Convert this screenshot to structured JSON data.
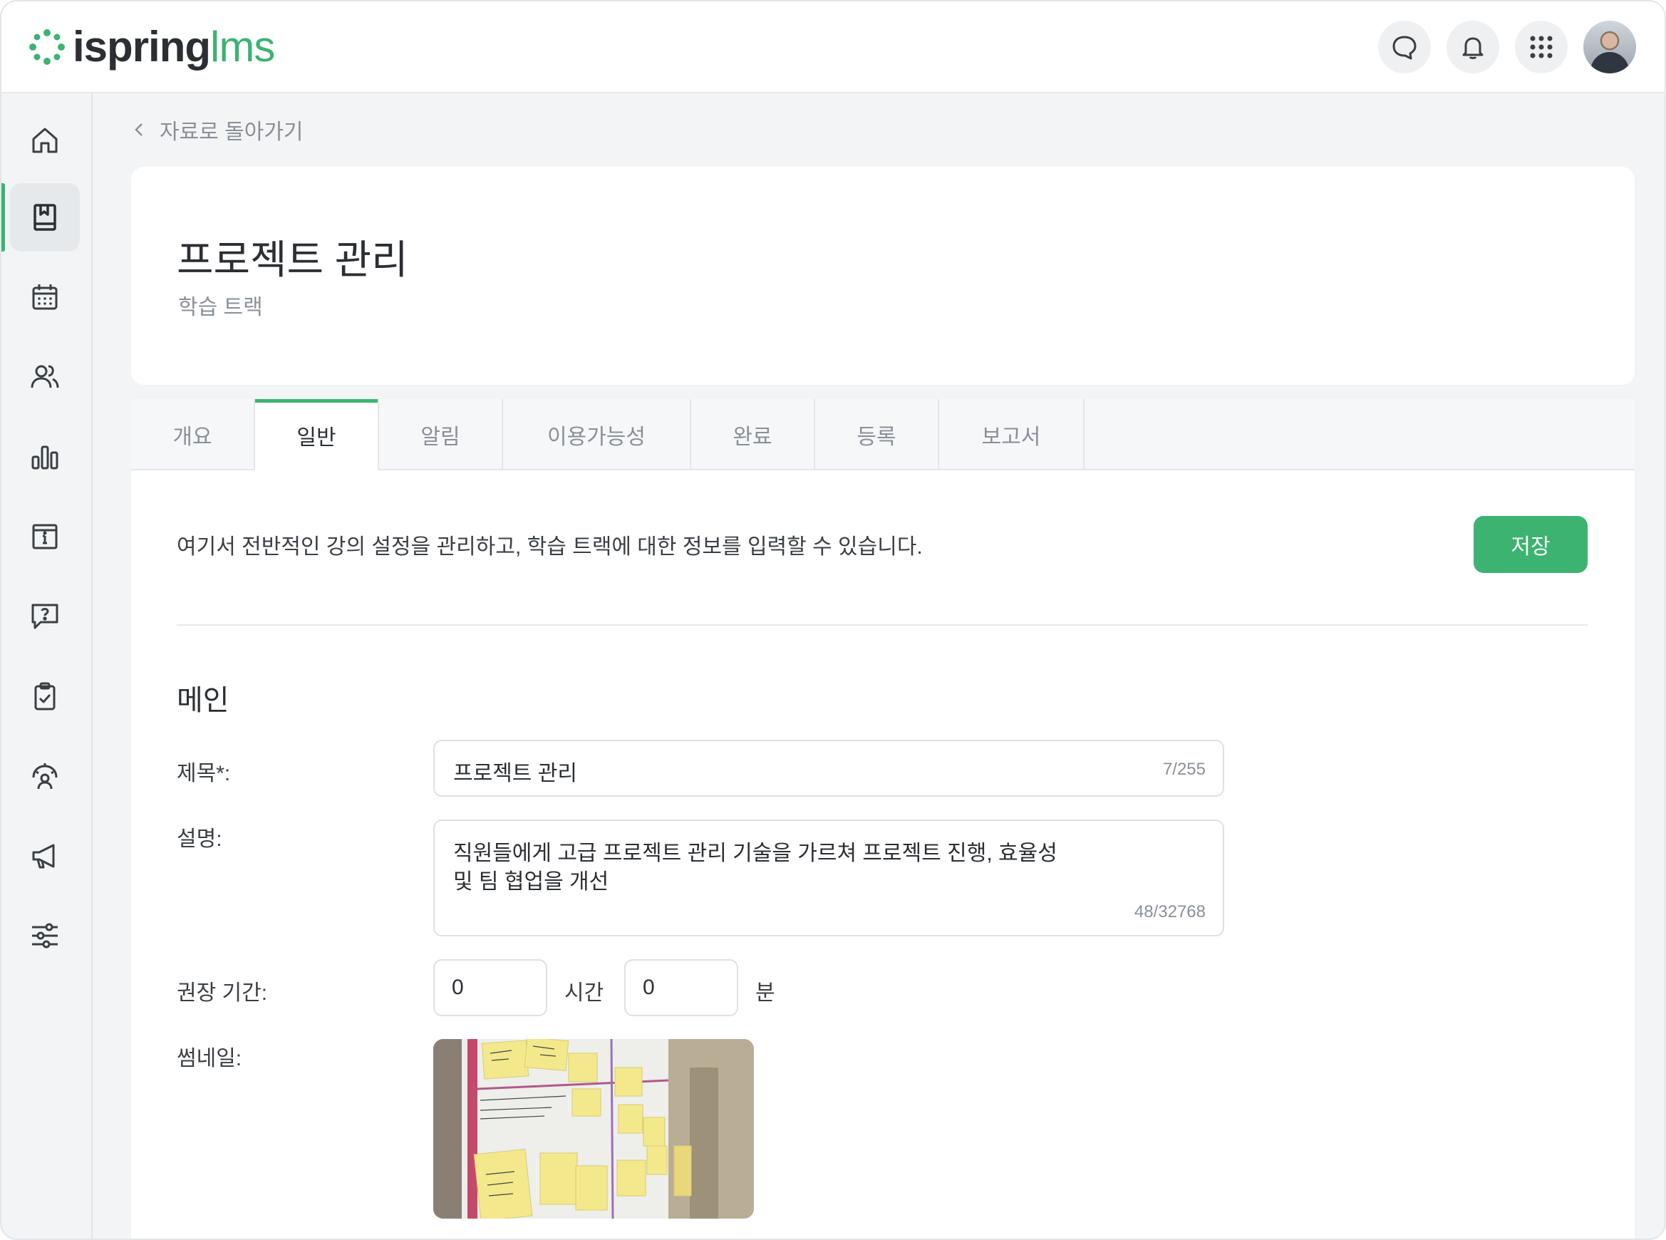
{
  "app": {
    "logo_primary": "ispring",
    "logo_secondary": "lms",
    "brand_color": "#3cb371"
  },
  "topbar": {
    "icons": [
      "chat-icon",
      "bell-icon",
      "apps-grid-icon"
    ],
    "avatar": "user-avatar"
  },
  "sidebar": {
    "items": [
      {
        "icon": "home-icon",
        "active": false
      },
      {
        "icon": "library-book-icon",
        "active": true
      },
      {
        "icon": "calendar-icon",
        "active": false
      },
      {
        "icon": "users-icon",
        "active": false
      },
      {
        "icon": "reports-chart-icon",
        "active": false
      },
      {
        "icon": "info-calendar-icon",
        "active": false
      },
      {
        "icon": "help-question-icon",
        "active": false
      },
      {
        "icon": "clipboard-check-icon",
        "active": false
      },
      {
        "icon": "user-gauge-icon",
        "active": false
      },
      {
        "icon": "megaphone-icon",
        "active": false
      },
      {
        "icon": "sliders-icon",
        "active": false
      }
    ]
  },
  "breadcrumb": {
    "back_label": "자료로 돌아가기"
  },
  "header": {
    "title": "프로젝트 관리",
    "subtitle": "학습 트랙"
  },
  "tabs": [
    {
      "label": "개요",
      "active": false
    },
    {
      "label": "일반",
      "active": true
    },
    {
      "label": "알림",
      "active": false
    },
    {
      "label": "이용가능성",
      "active": false
    },
    {
      "label": "완료",
      "active": false
    },
    {
      "label": "등록",
      "active": false
    },
    {
      "label": "보고서",
      "active": false
    }
  ],
  "general": {
    "intro": "여기서 전반적인 강의 설정을 관리하고, 학습 트랙에 대한 정보를 입력할 수 있습니다.",
    "save_label": "저장",
    "section_title": "메인",
    "title_label": "제목*:",
    "title_value": "프로젝트 관리",
    "title_counter": "7/255",
    "description_label": "설명:",
    "description_line1": "직원들에게 고급 프로젝트 관리 기술을 가르쳐 프로젝트 진행, 효율성",
    "description_line2": "및 팀 협업을 개선",
    "description_counter": "48/32768",
    "duration_label": "권장 기간:",
    "hours_value": "0",
    "hours_unit": "시간",
    "minutes_value": "0",
    "minutes_unit": "분",
    "thumbnail_label": "썸네일:"
  }
}
